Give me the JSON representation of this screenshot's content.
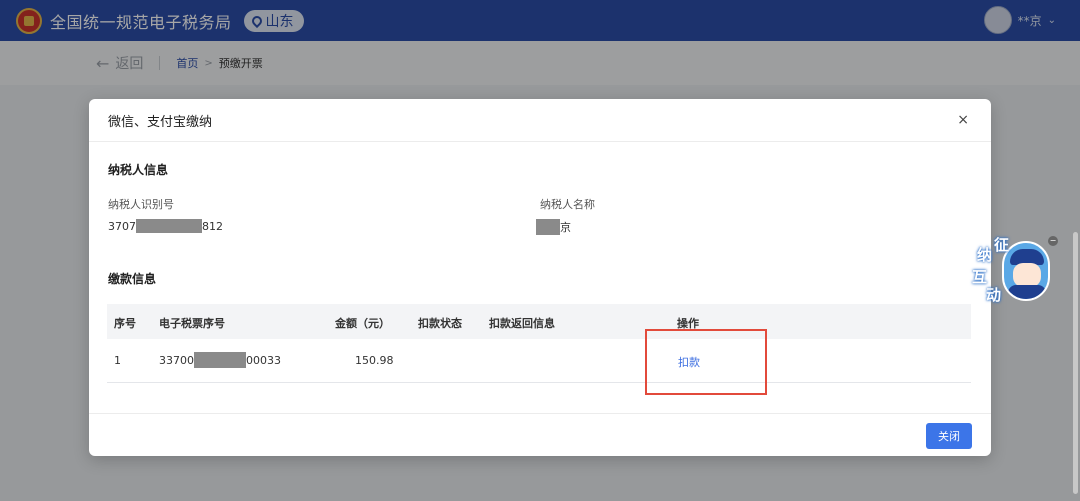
{
  "header": {
    "site_title": "全国统一规范电子税务局",
    "region": "山东",
    "user_name": "**京",
    "colors": {
      "header_bg": "#2b4ea8",
      "accent": "#3c75e8",
      "highlight": "#e24a3b"
    }
  },
  "subbar": {
    "back_label": "返回",
    "breadcrumb_home": "首页",
    "breadcrumb_separator": ">",
    "breadcrumb_current": "预缴开票"
  },
  "modal": {
    "title": "微信、支付宝缴纳",
    "close_icon": "×",
    "taxpayer_section": {
      "title": "纳税人信息",
      "id_label": "纳税人识别号",
      "id_value_prefix": "3707",
      "id_value_suffix": "812",
      "name_label": "纳税人名称",
      "name_value_suffix": "京"
    },
    "payment_section": {
      "title": "缴款信息",
      "columns": [
        "序号",
        "电子税票序号",
        "金额（元）",
        "扣款状态",
        "扣款返回信息",
        "操作"
      ],
      "rows": [
        {
          "index": "1",
          "ticket_prefix": "33700",
          "ticket_suffix": "00033",
          "amount": "150.98",
          "status": "",
          "return_info": "",
          "action": "扣款"
        }
      ]
    },
    "footer": {
      "close_button": "关闭"
    }
  },
  "mascot": {
    "chars": [
      "征",
      "纳",
      "互",
      "动"
    ],
    "minimize_icon": "−"
  }
}
